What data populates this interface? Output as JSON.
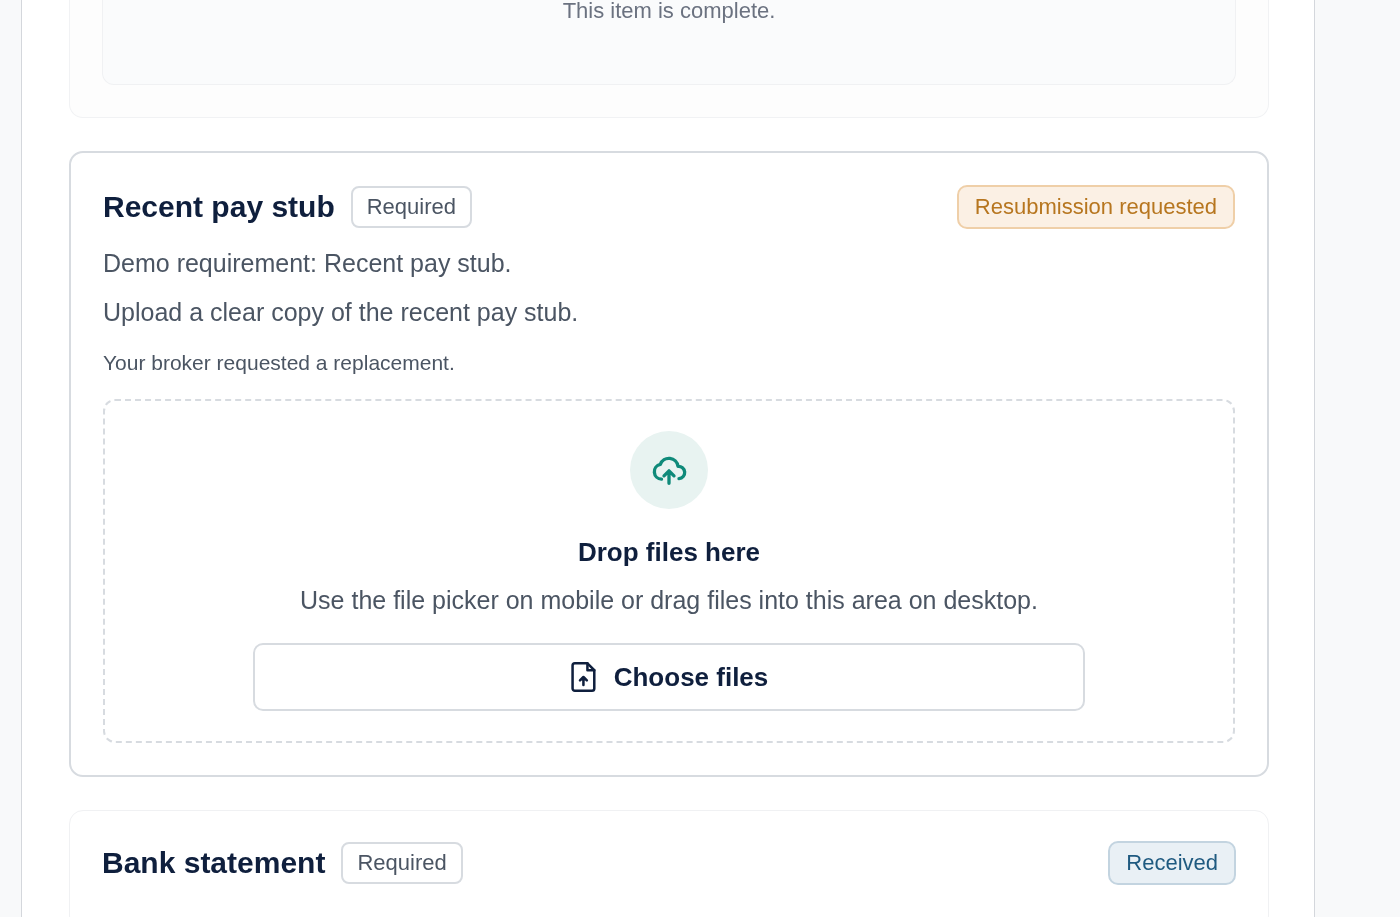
{
  "items": [
    {
      "kind": "complete",
      "message": "This item is complete."
    },
    {
      "kind": "upload",
      "title": "Recent pay stub",
      "tag": "Required",
      "status": {
        "label": "Resubmission requested",
        "kind": "warning"
      },
      "description": "Demo requirement: Recent pay stub.",
      "instructions": "Upload a clear copy of the recent pay stub.",
      "note": "Your broker requested a replacement.",
      "dropzone": {
        "title": "Drop files here",
        "hint": "Use the file picker on mobile or drag files into this area on desktop.",
        "button": "Choose files"
      }
    },
    {
      "kind": "header",
      "title": "Bank statement",
      "tag": "Required",
      "status": {
        "label": "Received",
        "kind": "info"
      }
    }
  ]
}
